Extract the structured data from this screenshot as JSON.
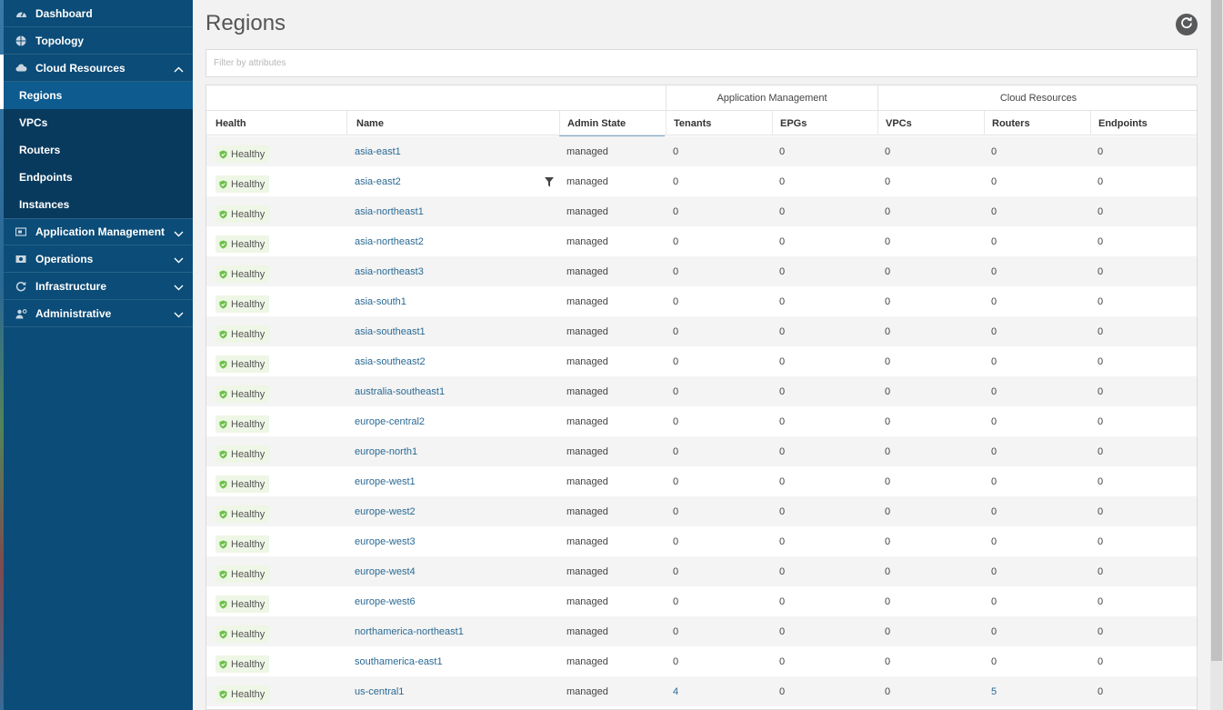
{
  "sidebar": {
    "items": [
      {
        "label": "Dashboard",
        "icon": "dashboard-icon"
      },
      {
        "label": "Topology",
        "icon": "topology-icon"
      },
      {
        "label": "Cloud Resources",
        "icon": "cloud-icon",
        "expanded": true
      },
      {
        "label": "Application Management",
        "icon": "app-management-icon"
      },
      {
        "label": "Operations",
        "icon": "operations-icon"
      },
      {
        "label": "Infrastructure",
        "icon": "infrastructure-icon"
      },
      {
        "label": "Administrative",
        "icon": "administrative-icon"
      }
    ],
    "sub_items": [
      {
        "label": "Regions",
        "selected": true
      },
      {
        "label": "VPCs"
      },
      {
        "label": "Routers"
      },
      {
        "label": "Endpoints"
      },
      {
        "label": "Instances"
      }
    ]
  },
  "page": {
    "title": "Regions",
    "filter_placeholder": "Filter by attributes"
  },
  "table": {
    "groups": [
      {
        "label": "Application Management"
      },
      {
        "label": "Cloud Resources"
      }
    ],
    "columns": [
      "Health",
      "Name",
      "Admin State",
      "Tenants",
      "EPGs",
      "VPCs",
      "Routers",
      "Endpoints"
    ],
    "rows": [
      {
        "health": "Healthy",
        "name": "asia-east1",
        "admin_state": "managed",
        "tenants": "0",
        "epgs": "0",
        "vpcs": "0",
        "routers": "0",
        "endpoints": "0"
      },
      {
        "health": "Healthy",
        "name": "asia-east2",
        "admin_state": "managed",
        "tenants": "0",
        "epgs": "0",
        "vpcs": "0",
        "routers": "0",
        "endpoints": "0"
      },
      {
        "health": "Healthy",
        "name": "asia-northeast1",
        "admin_state": "managed",
        "tenants": "0",
        "epgs": "0",
        "vpcs": "0",
        "routers": "0",
        "endpoints": "0"
      },
      {
        "health": "Healthy",
        "name": "asia-northeast2",
        "admin_state": "managed",
        "tenants": "0",
        "epgs": "0",
        "vpcs": "0",
        "routers": "0",
        "endpoints": "0"
      },
      {
        "health": "Healthy",
        "name": "asia-northeast3",
        "admin_state": "managed",
        "tenants": "0",
        "epgs": "0",
        "vpcs": "0",
        "routers": "0",
        "endpoints": "0"
      },
      {
        "health": "Healthy",
        "name": "asia-south1",
        "admin_state": "managed",
        "tenants": "0",
        "epgs": "0",
        "vpcs": "0",
        "routers": "0",
        "endpoints": "0"
      },
      {
        "health": "Healthy",
        "name": "asia-southeast1",
        "admin_state": "managed",
        "tenants": "0",
        "epgs": "0",
        "vpcs": "0",
        "routers": "0",
        "endpoints": "0"
      },
      {
        "health": "Healthy",
        "name": "asia-southeast2",
        "admin_state": "managed",
        "tenants": "0",
        "epgs": "0",
        "vpcs": "0",
        "routers": "0",
        "endpoints": "0"
      },
      {
        "health": "Healthy",
        "name": "australia-southeast1",
        "admin_state": "managed",
        "tenants": "0",
        "epgs": "0",
        "vpcs": "0",
        "routers": "0",
        "endpoints": "0"
      },
      {
        "health": "Healthy",
        "name": "europe-central2",
        "admin_state": "managed",
        "tenants": "0",
        "epgs": "0",
        "vpcs": "0",
        "routers": "0",
        "endpoints": "0"
      },
      {
        "health": "Healthy",
        "name": "europe-north1",
        "admin_state": "managed",
        "tenants": "0",
        "epgs": "0",
        "vpcs": "0",
        "routers": "0",
        "endpoints": "0"
      },
      {
        "health": "Healthy",
        "name": "europe-west1",
        "admin_state": "managed",
        "tenants": "0",
        "epgs": "0",
        "vpcs": "0",
        "routers": "0",
        "endpoints": "0"
      },
      {
        "health": "Healthy",
        "name": "europe-west2",
        "admin_state": "managed",
        "tenants": "0",
        "epgs": "0",
        "vpcs": "0",
        "routers": "0",
        "endpoints": "0"
      },
      {
        "health": "Healthy",
        "name": "europe-west3",
        "admin_state": "managed",
        "tenants": "0",
        "epgs": "0",
        "vpcs": "0",
        "routers": "0",
        "endpoints": "0"
      },
      {
        "health": "Healthy",
        "name": "europe-west4",
        "admin_state": "managed",
        "tenants": "0",
        "epgs": "0",
        "vpcs": "0",
        "routers": "0",
        "endpoints": "0"
      },
      {
        "health": "Healthy",
        "name": "europe-west6",
        "admin_state": "managed",
        "tenants": "0",
        "epgs": "0",
        "vpcs": "0",
        "routers": "0",
        "endpoints": "0"
      },
      {
        "health": "Healthy",
        "name": "northamerica-northeast1",
        "admin_state": "managed",
        "tenants": "0",
        "epgs": "0",
        "vpcs": "0",
        "routers": "0",
        "endpoints": "0"
      },
      {
        "health": "Healthy",
        "name": "southamerica-east1",
        "admin_state": "managed",
        "tenants": "0",
        "epgs": "0",
        "vpcs": "0",
        "routers": "0",
        "endpoints": "0"
      },
      {
        "health": "Healthy",
        "name": "us-central1",
        "admin_state": "managed",
        "tenants": "4",
        "epgs": "0",
        "vpcs": "0",
        "routers": "5",
        "endpoints": "0"
      }
    ]
  },
  "colors": {
    "sidebar_bg": "#0b4c78",
    "sub_bg": "#083a5e",
    "selected_bg": "#0d5b8f",
    "link": "#2a6a94",
    "healthy": "#6cc04a"
  }
}
